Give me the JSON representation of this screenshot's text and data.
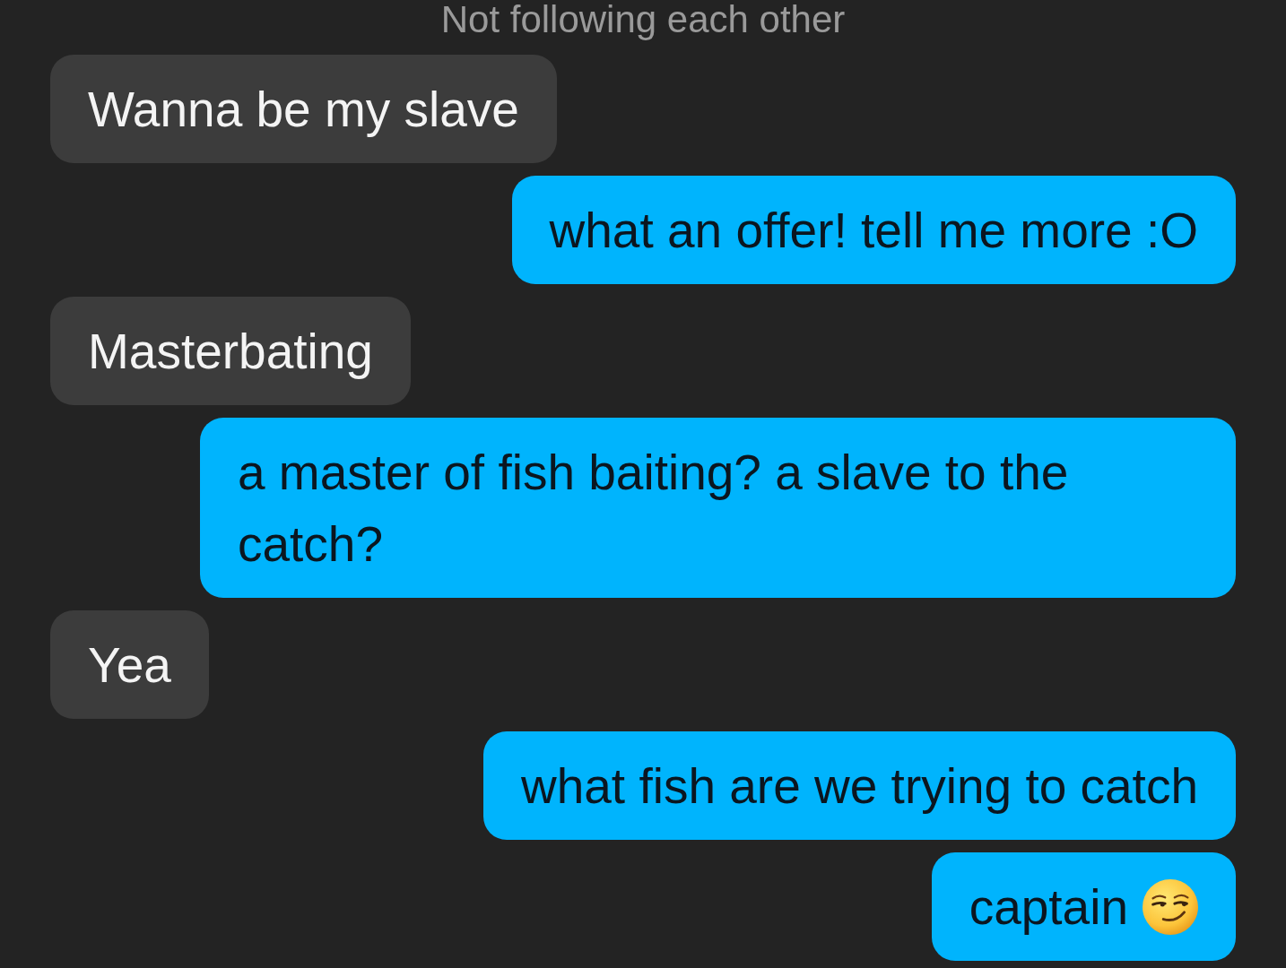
{
  "header": {
    "status": "Not following each other"
  },
  "messages": [
    {
      "outgoing": false,
      "kind": "text",
      "text": "Wanna be my slave"
    },
    {
      "outgoing": true,
      "kind": "text",
      "text": "what an offer! tell me more :O"
    },
    {
      "outgoing": false,
      "kind": "text",
      "text": "Masterbating"
    },
    {
      "outgoing": true,
      "kind": "text",
      "text": "a master of fish baiting? a slave to the catch?"
    },
    {
      "outgoing": false,
      "kind": "text",
      "text": "Yea"
    },
    {
      "outgoing": true,
      "kind": "text",
      "text": "what fish are we trying to catch"
    },
    {
      "outgoing": true,
      "kind": "text_emoji",
      "text": "captain"
    }
  ]
}
